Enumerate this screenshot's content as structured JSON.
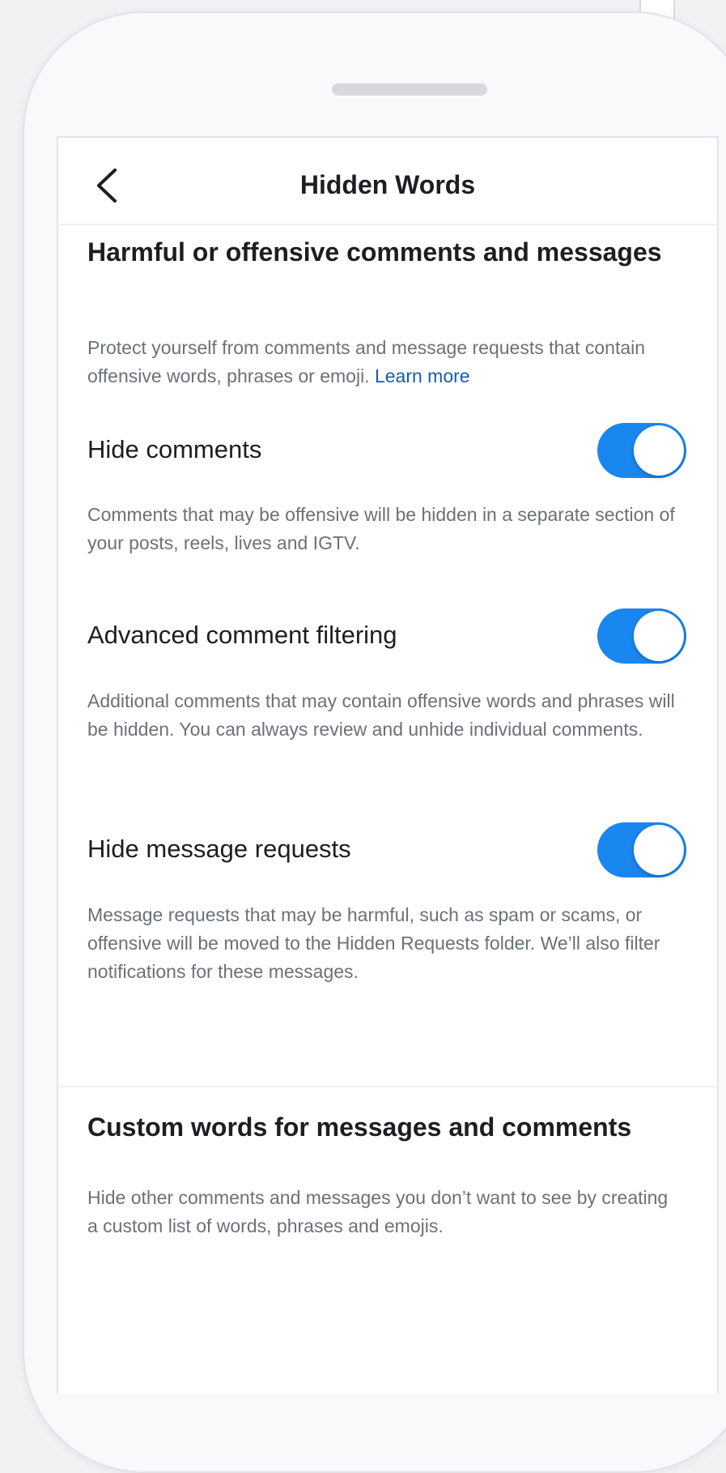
{
  "header": {
    "title": "Hidden Words"
  },
  "harmful": {
    "title": "Harmful or offensive comments and messages",
    "description": "Protect yourself from comments and message requests that contain offensive words, phrases or emoji.",
    "learn_more": "Learn more"
  },
  "settings": [
    {
      "label": "Hide comments",
      "enabled": true,
      "description": "Comments that may be offensive will be hidden in a separate section of your posts, reels, lives and IGTV."
    },
    {
      "label": "Advanced comment filtering",
      "enabled": true,
      "description": "Additional comments that may contain offensive words and phrases will be hidden. You can always review and unhide individual comments."
    },
    {
      "label": "Hide message requests",
      "enabled": true,
      "description": "Message requests that may be harmful, such as spam or scams, or offensive will be moved to the Hidden Requests folder. We’ll also filter notifications for these messages."
    }
  ],
  "custom": {
    "title": "Custom words for messages and comments",
    "description": "Hide other comments and messages you don’t want to see by creating a custom list of words, phrases and emojis."
  },
  "colors": {
    "toggle_on": "#1a87f0",
    "link": "#1a5cab"
  }
}
